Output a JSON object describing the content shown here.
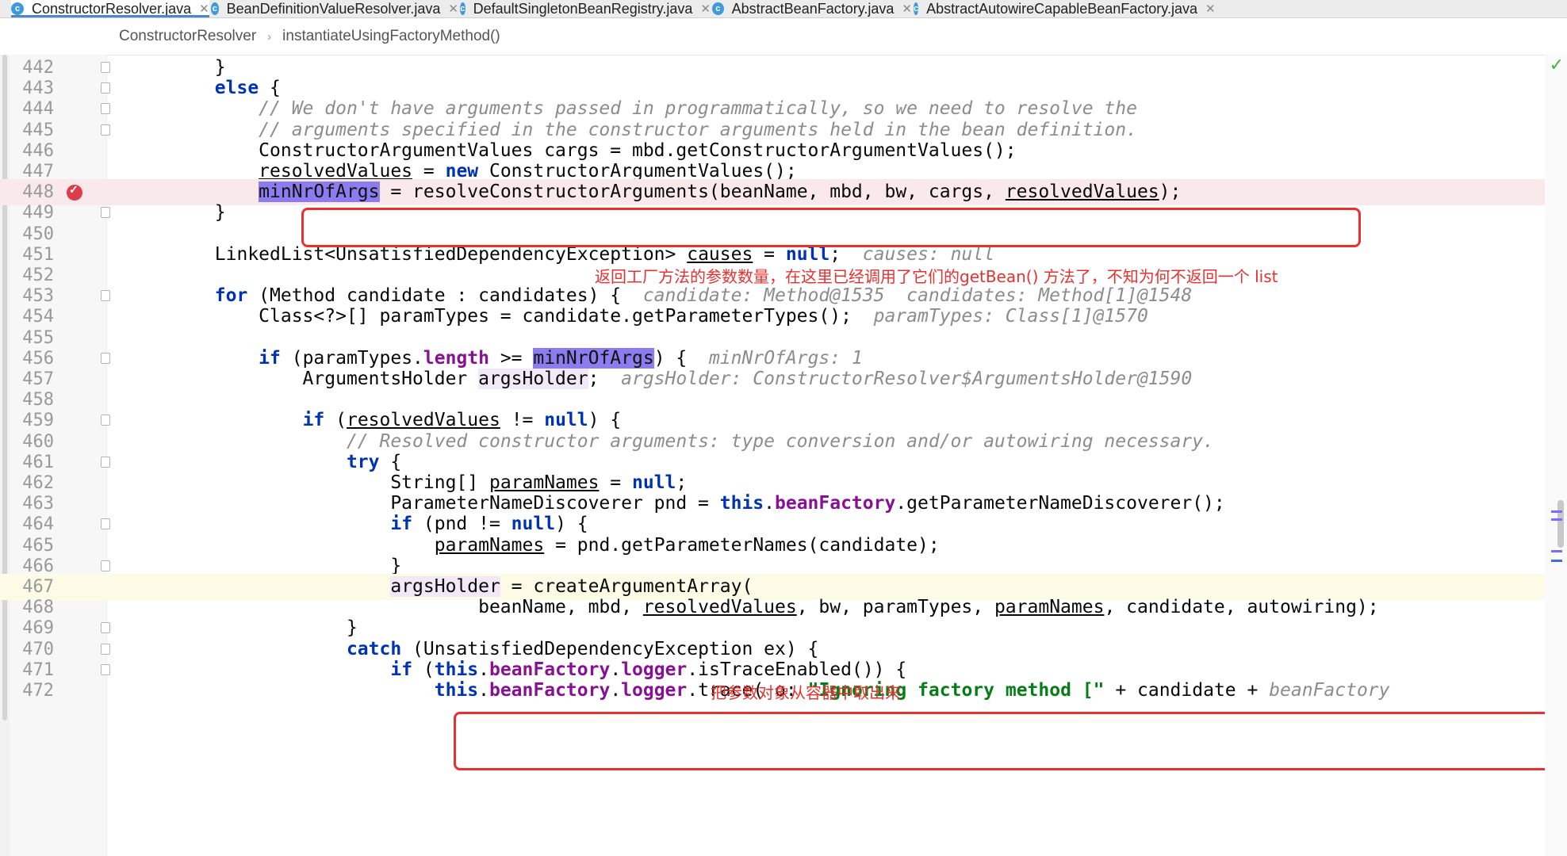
{
  "tabs": [
    {
      "label": "ConstructorResolver.java",
      "icon": "c",
      "active": true
    },
    {
      "label": "BeanDefinitionValueResolver.java",
      "icon": "c",
      "active": false
    },
    {
      "label": "DefaultSingletonBeanRegistry.java",
      "icon": "c",
      "active": false
    },
    {
      "label": "AbstractBeanFactory.java",
      "icon": "c",
      "active": false
    },
    {
      "label": "AbstractAutowireCapableBeanFactory.java",
      "icon": "c",
      "active": false
    }
  ],
  "breadcrumb": [
    "ConstructorResolver",
    "instantiateUsingFactoryMethod()"
  ],
  "colors": {
    "keyword": "#0033b3",
    "comment": "#8c8c8c",
    "field": "#871094",
    "highlight": "#8b7cf0",
    "annotation": "#e8312f",
    "hint": "#8c8c8c"
  },
  "annotations": [
    "返回工厂方法的参数数量，在这里已经调用了它们的getBean() 方法了，不知为何不返回一个 list",
    "把参数对象从容器中取出来"
  ],
  "lines": [
    {
      "n": "442",
      "fold": true,
      "tokens": [
        {
          "t": "        }"
        }
      ]
    },
    {
      "n": "443",
      "fold": true,
      "tokens": [
        {
          "t": "        "
        },
        {
          "t": "else",
          "c": "kw"
        },
        {
          "t": " {"
        }
      ]
    },
    {
      "n": "444",
      "fold": true,
      "tokens": [
        {
          "t": "            "
        },
        {
          "t": "// We don't have arguments passed in programmatically, so we need to resolve the",
          "c": "cm"
        }
      ]
    },
    {
      "n": "445",
      "fold": true,
      "tokens": [
        {
          "t": "            "
        },
        {
          "t": "// arguments specified in the constructor arguments held in the bean definition.",
          "c": "cm"
        }
      ]
    },
    {
      "n": "446",
      "tokens": [
        {
          "t": "            ConstructorArgumentValues cargs = mbd.getConstructorArgumentValues();"
        }
      ]
    },
    {
      "n": "447",
      "tokens": [
        {
          "t": "            "
        },
        {
          "t": "resolvedValues",
          "c": "ul"
        },
        {
          "t": " = "
        },
        {
          "t": "new",
          "c": "kw"
        },
        {
          "t": " ConstructorArgumentValues();"
        }
      ]
    },
    {
      "n": "448",
      "bp": true,
      "tokens": [
        {
          "t": "            "
        },
        {
          "t": "minNrOfArgs",
          "c": "hl"
        },
        {
          "t": " = resolveConstructorArguments(beanName, mbd, bw, cargs, "
        },
        {
          "t": "resolvedValues",
          "c": "ul"
        },
        {
          "t": ");"
        }
      ]
    },
    {
      "n": "449",
      "fold": true,
      "tokens": [
        {
          "t": "        }"
        }
      ]
    },
    {
      "n": "450",
      "tokens": [
        {
          "t": ""
        }
      ]
    },
    {
      "n": "451",
      "tokens": [
        {
          "t": "        LinkedList<UnsatisfiedDependencyException> "
        },
        {
          "t": "causes",
          "c": "ul"
        },
        {
          "t": " = "
        },
        {
          "t": "null",
          "c": "kw"
        },
        {
          "t": ";  "
        },
        {
          "t": "causes: null",
          "c": "hint"
        }
      ]
    },
    {
      "n": "452",
      "tokens": [
        {
          "t": ""
        }
      ]
    },
    {
      "n": "453",
      "fold": true,
      "tokens": [
        {
          "t": "        "
        },
        {
          "t": "for",
          "c": "kw"
        },
        {
          "t": " (Method candidate : candidates) {  "
        },
        {
          "t": "candidate: Method@1535  candidates: Method[1]@1548",
          "c": "hint"
        }
      ]
    },
    {
      "n": "454",
      "tokens": [
        {
          "t": "            Class<?>[] paramTypes = candidate.getParameterTypes();  "
        },
        {
          "t": "paramTypes: Class[1]@1570",
          "c": "hint"
        }
      ]
    },
    {
      "n": "455",
      "tokens": [
        {
          "t": ""
        }
      ]
    },
    {
      "n": "456",
      "fold": true,
      "tokens": [
        {
          "t": "            "
        },
        {
          "t": "if",
          "c": "kw"
        },
        {
          "t": " (paramTypes."
        },
        {
          "t": "length",
          "c": "fld"
        },
        {
          "t": " >= "
        },
        {
          "t": "minNrOfArgs",
          "c": "hl"
        },
        {
          "t": ") {  "
        },
        {
          "t": "minNrOfArgs: 1",
          "c": "hint"
        }
      ]
    },
    {
      "n": "457",
      "tokens": [
        {
          "t": "                ArgumentsHolder "
        },
        {
          "t": "argsHolder",
          "c": "pk"
        },
        {
          "t": ";  "
        },
        {
          "t": "argsHolder: ConstructorResolver$ArgumentsHolder@1590",
          "c": "hint"
        }
      ]
    },
    {
      "n": "458",
      "tokens": [
        {
          "t": ""
        }
      ]
    },
    {
      "n": "459",
      "fold": true,
      "tokens": [
        {
          "t": "                "
        },
        {
          "t": "if",
          "c": "kw"
        },
        {
          "t": " ("
        },
        {
          "t": "resolvedValues",
          "c": "ul"
        },
        {
          "t": " != "
        },
        {
          "t": "null",
          "c": "kw"
        },
        {
          "t": ") {"
        }
      ]
    },
    {
      "n": "460",
      "tokens": [
        {
          "t": "                    "
        },
        {
          "t": "// Resolved constructor arguments: type conversion and/or autowiring necessary.",
          "c": "cm"
        }
      ]
    },
    {
      "n": "461",
      "fold": true,
      "tokens": [
        {
          "t": "                    "
        },
        {
          "t": "try",
          "c": "kw"
        },
        {
          "t": " {"
        }
      ]
    },
    {
      "n": "462",
      "tokens": [
        {
          "t": "                        String[] "
        },
        {
          "t": "paramNames",
          "c": "ul"
        },
        {
          "t": " = "
        },
        {
          "t": "null",
          "c": "kw"
        },
        {
          "t": ";"
        }
      ]
    },
    {
      "n": "463",
      "tokens": [
        {
          "t": "                        ParameterNameDiscoverer pnd = "
        },
        {
          "t": "this",
          "c": "kw"
        },
        {
          "t": "."
        },
        {
          "t": "beanFactory",
          "c": "fld"
        },
        {
          "t": ".getParameterNameDiscoverer();"
        }
      ]
    },
    {
      "n": "464",
      "fold": true,
      "tokens": [
        {
          "t": "                        "
        },
        {
          "t": "if",
          "c": "kw"
        },
        {
          "t": " (pnd != "
        },
        {
          "t": "null",
          "c": "kw"
        },
        {
          "t": ") {"
        }
      ]
    },
    {
      "n": "465",
      "tokens": [
        {
          "t": "                            "
        },
        {
          "t": "paramNames",
          "c": "ul"
        },
        {
          "t": " = pnd.getParameterNames(candidate);"
        }
      ]
    },
    {
      "n": "466",
      "fold": true,
      "tokens": [
        {
          "t": "                        }"
        }
      ]
    },
    {
      "n": "467",
      "caret": true,
      "tokens": [
        {
          "t": "                        "
        },
        {
          "t": "argsHolder",
          "c": "pk"
        },
        {
          "t": " = createArgumentArray("
        }
      ]
    },
    {
      "n": "468",
      "tokens": [
        {
          "t": "                                beanName, mbd, "
        },
        {
          "t": "resolvedValues",
          "c": "ul"
        },
        {
          "t": ", bw, paramTypes, "
        },
        {
          "t": "paramNames",
          "c": "ul"
        },
        {
          "t": ", candidate, autowiring);"
        }
      ]
    },
    {
      "n": "469",
      "fold": true,
      "tokens": [
        {
          "t": "                    }"
        }
      ]
    },
    {
      "n": "470",
      "fold": true,
      "tokens": [
        {
          "t": "                    "
        },
        {
          "t": "catch",
          "c": "kw"
        },
        {
          "t": " (UnsatisfiedDependencyException ex) {"
        }
      ]
    },
    {
      "n": "471",
      "fold": true,
      "tokens": [
        {
          "t": "                        "
        },
        {
          "t": "if",
          "c": "kw"
        },
        {
          "t": " ("
        },
        {
          "t": "this",
          "c": "kw"
        },
        {
          "t": "."
        },
        {
          "t": "beanFactory",
          "c": "fld"
        },
        {
          "t": "."
        },
        {
          "t": "logger",
          "c": "fld"
        },
        {
          "t": ".isTraceEnabled()) {"
        }
      ]
    },
    {
      "n": "472",
      "tokens": [
        {
          "t": "                            "
        },
        {
          "t": "this",
          "c": "kw"
        },
        {
          "t": "."
        },
        {
          "t": "beanFactory",
          "c": "fld"
        },
        {
          "t": "."
        },
        {
          "t": "logger",
          "c": "fld"
        },
        {
          "t": ".trace( o: "
        },
        {
          "t": "\"Ignoring factory method [\"",
          "c": "str"
        },
        {
          "t": " + candidate + "
        },
        {
          "t": "beanFactory",
          "c": "hint"
        }
      ]
    }
  ]
}
